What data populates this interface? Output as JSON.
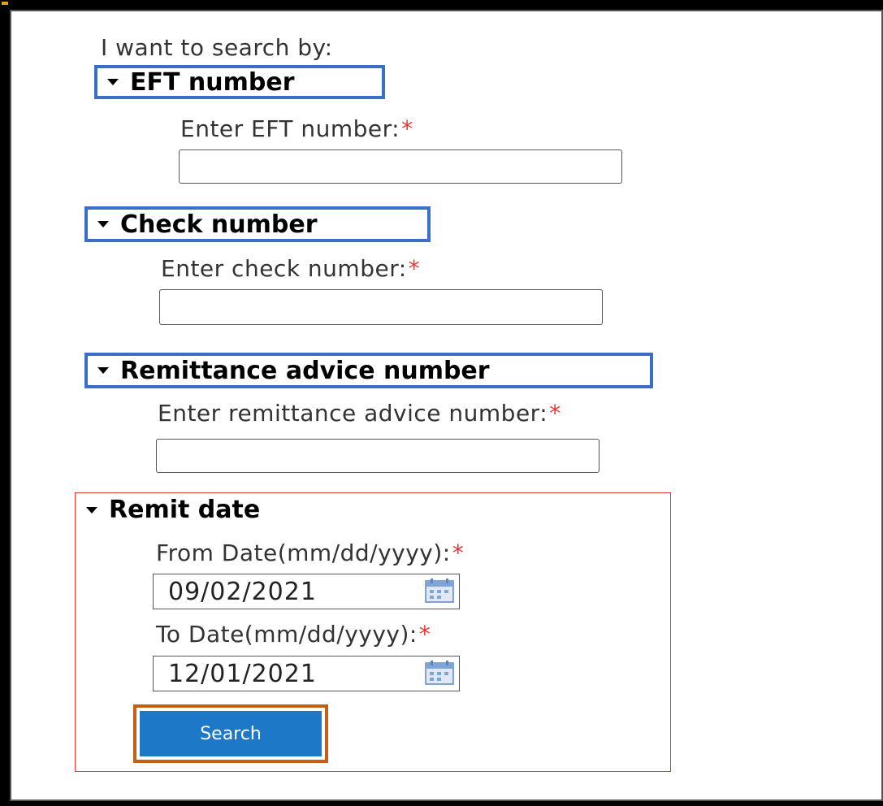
{
  "intro": "I want to search by:",
  "sections": {
    "eft": {
      "title": "EFT number",
      "label": "Enter EFT number:",
      "required": "*",
      "value": ""
    },
    "check": {
      "title": "Check number",
      "label": "Enter check number:",
      "required": "*",
      "value": ""
    },
    "remittance": {
      "title": "Remittance advice number",
      "label": "Enter remittance advice number:",
      "required": "*",
      "value": ""
    },
    "remit_date": {
      "title": "Remit date",
      "from_label": "From Date(mm/dd/yyyy):",
      "from_value": "09/02/2021",
      "to_label": "To Date(mm/dd/yyyy):",
      "to_value": "12/01/2021",
      "required": "*"
    }
  },
  "search_label": "Search",
  "icons": {
    "caret": "caret-down-icon",
    "calendar": "calendar-icon"
  },
  "colors": {
    "section_border": "#3a6fc8",
    "remit_border": "#e53935",
    "search_button": "#1e78c8",
    "search_highlight": "#c0601a",
    "required": "#e53935"
  }
}
